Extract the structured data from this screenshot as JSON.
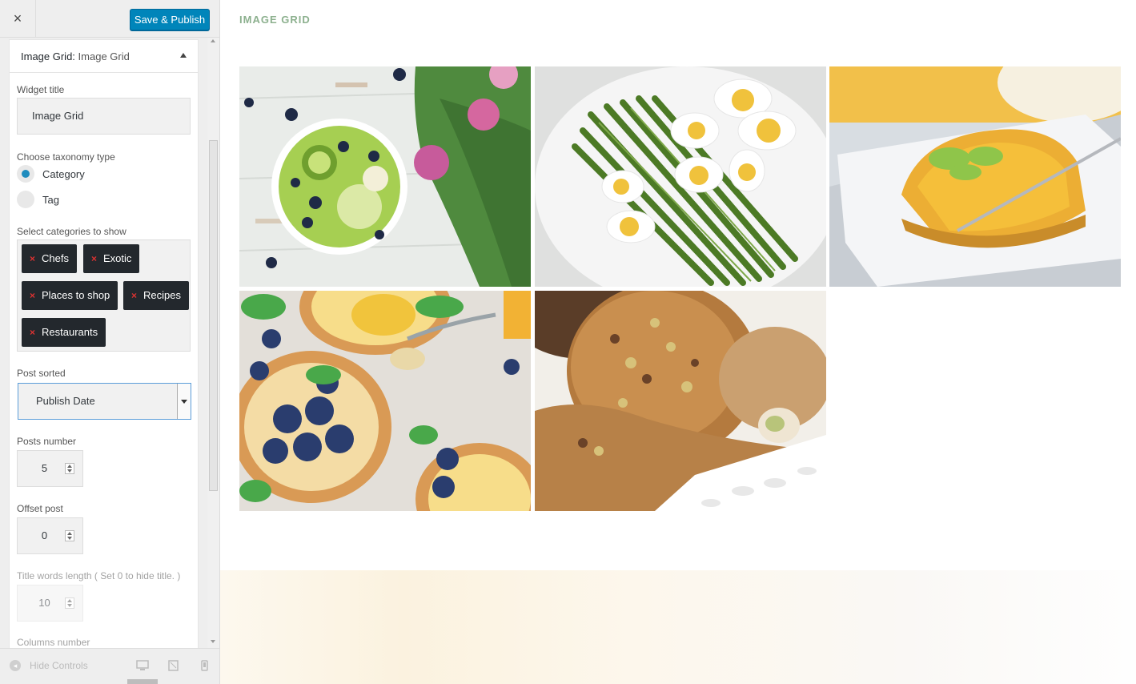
{
  "toolbar": {
    "close_icon": "×",
    "publish_label": "Save & Publish"
  },
  "widget": {
    "header_type": "Image Grid:",
    "header_name": "Image Grid",
    "title_label": "Widget title",
    "title_value": "Image Grid",
    "taxonomy_label": "Choose taxonomy type",
    "taxonomy_options": [
      {
        "label": "Category",
        "checked": true
      },
      {
        "label": "Tag",
        "checked": false
      }
    ],
    "categories_label": "Select categories to show",
    "categories": [
      "Chefs",
      "Exotic",
      "Places to shop",
      "Recipes",
      "Restaurants"
    ],
    "chip_remove": "×",
    "sort_label": "Post sorted",
    "sort_value": "Publish Date",
    "posts_number_label": "Posts number",
    "posts_number_value": "5",
    "offset_label": "Offset post",
    "offset_value": "0",
    "title_words_label": "Title words length ( Set 0 to hide title. )",
    "title_words_value": "10",
    "columns_label": "Columns number"
  },
  "footer": {
    "hide_controls": "Hide Controls",
    "hide_icon": "◂",
    "devices": [
      "desktop-icon",
      "tablet-icon",
      "mobile-icon"
    ]
  },
  "preview": {
    "heading": "IMAGE GRID",
    "images": [
      "fruit-bowl-flowers",
      "asparagus-eggs",
      "orange-tart-slice",
      "blueberry-tarts",
      "pistachio-cookies"
    ]
  },
  "colors": {
    "accent": "#0085ba",
    "heading": "#8cb08e",
    "chip": "#23282d",
    "chip_x": "#dc3232"
  }
}
